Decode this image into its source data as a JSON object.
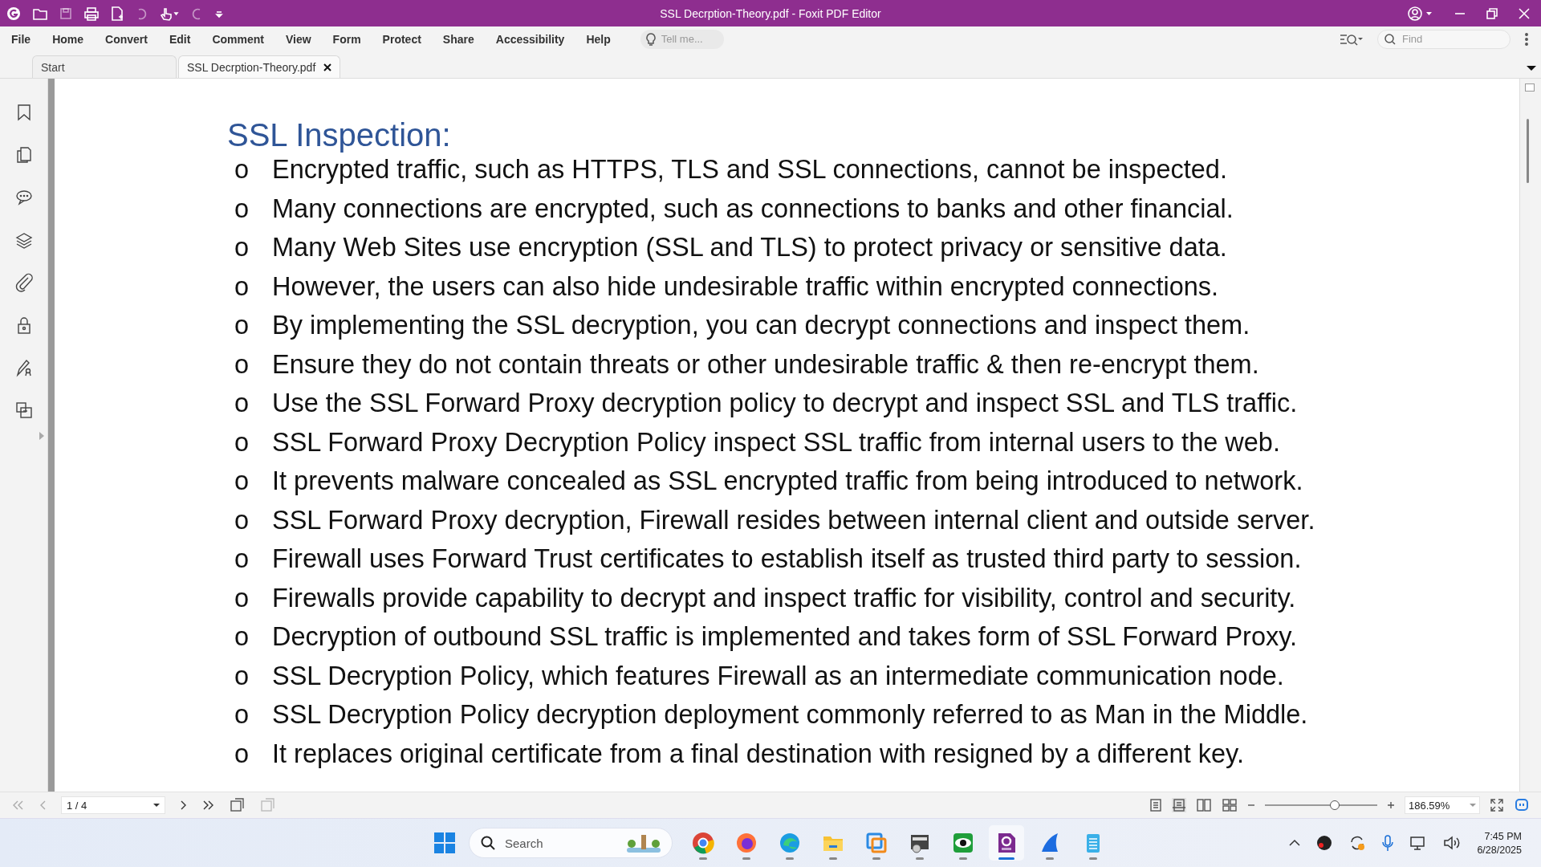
{
  "window": {
    "title": "SSL Decrption-Theory.pdf - Foxit PDF Editor"
  },
  "menu": [
    "File",
    "Home",
    "Convert",
    "Edit",
    "Comment",
    "View",
    "Form",
    "Protect",
    "Share",
    "Accessibility",
    "Help"
  ],
  "tell_me": {
    "placeholder": "Tell me..."
  },
  "find": {
    "placeholder": "Find"
  },
  "tabs": [
    {
      "label": "Start",
      "selected": false
    },
    {
      "label": "SSL Decrption-Theory.pdf",
      "selected": true
    }
  ],
  "document": {
    "heading": "SSL Inspection:",
    "items": [
      {
        "marker": "o",
        "text": "Encrypted traffic, such as HTTPS, TLS and SSL connections, cannot be inspected."
      },
      {
        "marker": "o",
        "text": "Many connections are encrypted, such as connections to banks and other financial."
      },
      {
        "marker": "o",
        "text": "Many Web Sites use encryption (SSL and TLS) to protect privacy or sensitive data."
      },
      {
        "marker": "o",
        "text": "However, the users can also hide undesirable traffic within encrypted connections."
      },
      {
        "marker": "o",
        "text": "By implementing the SSL decryption, you can decrypt connections and inspect them."
      },
      {
        "marker": "o",
        "text": "Ensure they do not contain threats or other undesirable traffic & then re-encrypt them."
      },
      {
        "marker": "o",
        "text": "Use the SSL Forward Proxy decryption policy to decrypt and inspect SSL and TLS traffic."
      },
      {
        "marker": "o",
        "text": "SSL Forward Proxy Decryption Policy inspect SSL traffic from internal users to the web."
      },
      {
        "marker": "o",
        "text": "It prevents malware concealed as SSL encrypted traffic from being introduced to network."
      },
      {
        "marker": "o",
        "text": "SSL Forward Proxy decryption, Firewall resides between internal client and outside server."
      },
      {
        "marker": "o",
        "text": "Firewall uses Forward Trust certificates to establish itself as trusted third party to session."
      },
      {
        "marker": "o",
        "text": "Firewalls provide capability to decrypt and inspect traffic for visibility, control and security."
      },
      {
        "marker": "o",
        "text": "Decryption of outbound SSL traffic is implemented and takes form of SSL Forward Proxy."
      },
      {
        "marker": "o",
        "text": "SSL Decryption Policy, which features Firewall as an intermediate communication node."
      },
      {
        "marker": "o",
        "text": "SSL Decryption Policy decryption deployment commonly referred to as Man in the Middle."
      },
      {
        "marker": "o",
        "text": "It replaces original certificate from a final destination with resigned by a different key."
      }
    ]
  },
  "status_bar": {
    "page": "1 / 4",
    "zoom": "186.59%",
    "zoom_slider": {
      "level": 0.62
    }
  },
  "taskbar": {
    "search": {
      "placeholder": "Search"
    },
    "time": "7:45 PM",
    "date": "6/28/2025",
    "apps": [
      {
        "kind": "chrome",
        "selected": false
      },
      {
        "kind": "firefox",
        "selected": false
      },
      {
        "kind": "edge",
        "selected": false
      },
      {
        "kind": "folder",
        "selected": false
      },
      {
        "kind": "remote",
        "selected": false
      },
      {
        "kind": "terminal",
        "selected": false
      },
      {
        "kind": "eye",
        "selected": false
      },
      {
        "kind": "pdf",
        "selected": true
      },
      {
        "kind": "fin",
        "selected": false
      },
      {
        "kind": "notepad",
        "selected": false
      }
    ]
  }
}
